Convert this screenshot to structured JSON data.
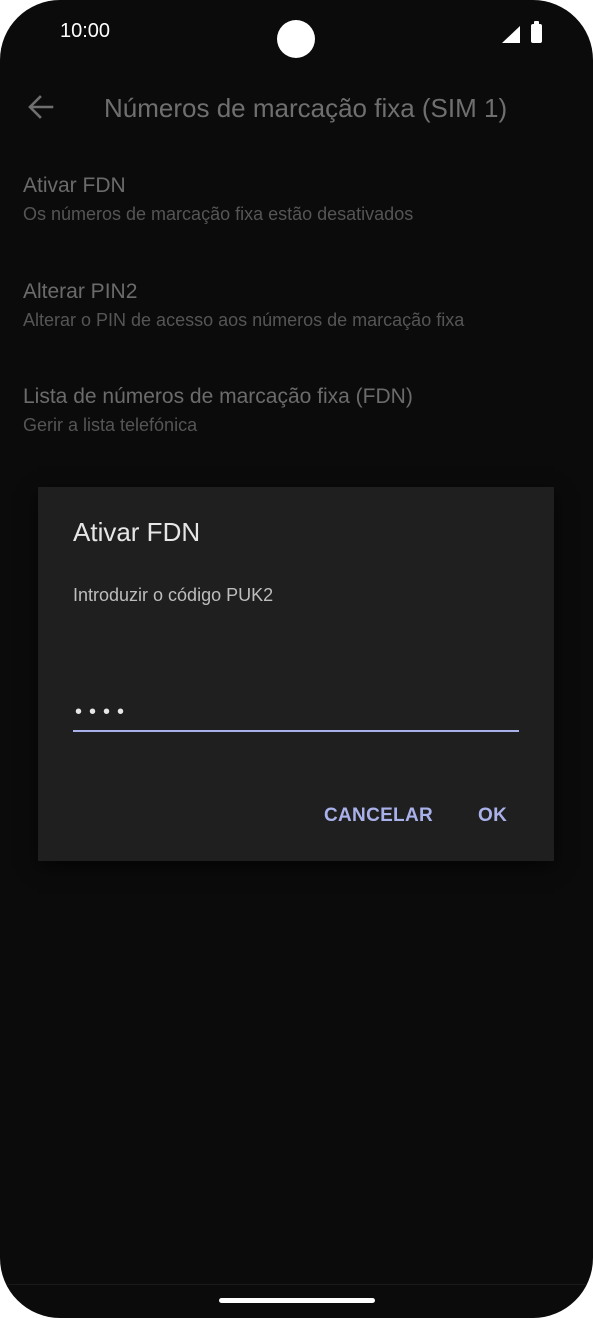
{
  "status_bar": {
    "time": "10:00",
    "icons": [
      "camera-cutout",
      "signal-icon",
      "battery-icon"
    ]
  },
  "app_bar": {
    "back_icon": "arrow-left-icon",
    "title": "Números de marcação fixa (SIM 1)"
  },
  "preferences": [
    {
      "title": "Ativar FDN",
      "summary": "Os números de marcação fixa estão desativados"
    },
    {
      "title": "Alterar PIN2",
      "summary": "Alterar o PIN de acesso aos números de marcação fixa"
    },
    {
      "title": "Lista de números de marcação fixa (FDN)",
      "summary": "Gerir a lista telefónica"
    }
  ],
  "dialog": {
    "title": "Ativar FDN",
    "message": "Introduzir o código PUK2",
    "input_value": "••••",
    "cancel_label": "CANCELAR",
    "ok_label": "OK"
  },
  "colors": {
    "background": "#0b0b0b",
    "dialog_background": "#1f1f1f",
    "accent": "#a9b1ea"
  }
}
